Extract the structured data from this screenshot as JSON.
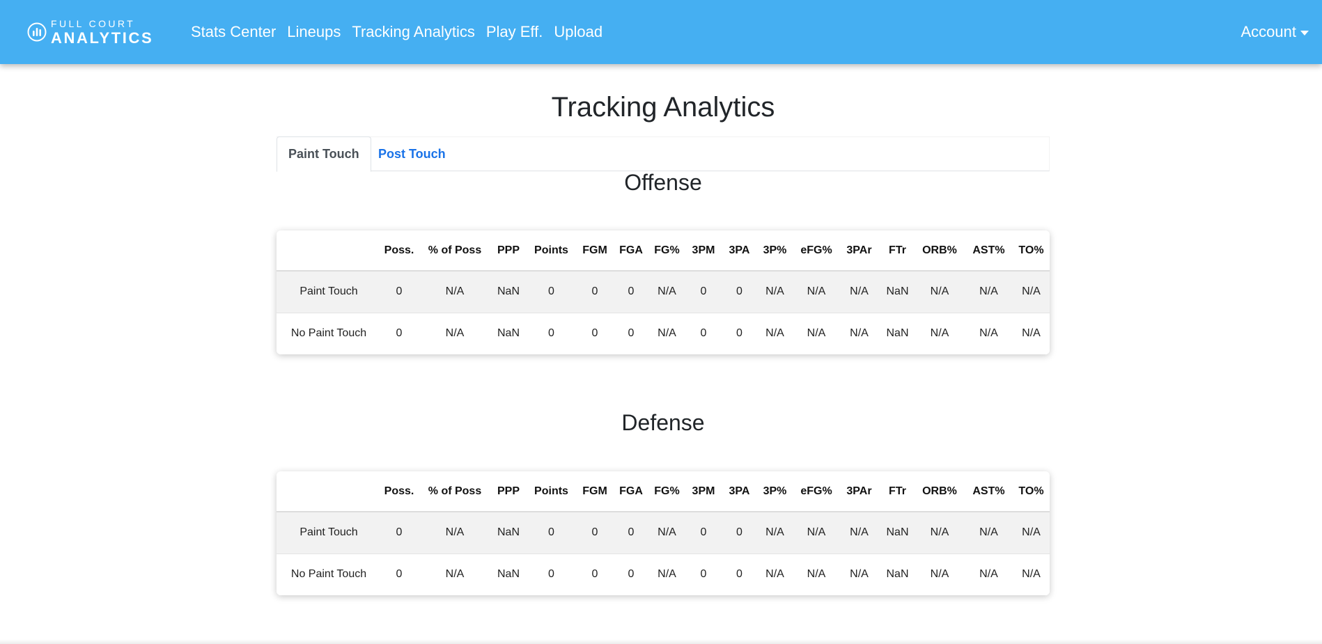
{
  "navbar": {
    "brand_top": "FULL COURT",
    "brand_bottom": "ANALYTICS",
    "links": [
      "Stats Center",
      "Lineups",
      "Tracking Analytics",
      "Play Eff.",
      "Upload"
    ],
    "account_label": "Account"
  },
  "page": {
    "title": "Tracking Analytics"
  },
  "tabs": [
    {
      "label": "Paint Touch",
      "active": true
    },
    {
      "label": "Post Touch",
      "active": false
    }
  ],
  "columns": [
    "",
    "Poss.",
    "% of Poss",
    "PPP",
    "Points",
    "FGM",
    "FGA",
    "FG%",
    "3PM",
    "3PA",
    "3P%",
    "eFG%",
    "3PAr",
    "FTr",
    "ORB%",
    "AST%",
    "TO%"
  ],
  "offense": {
    "title": "Offense",
    "rows": [
      [
        "Paint Touch",
        "0",
        "N/A",
        "NaN",
        "0",
        "0",
        "0",
        "N/A",
        "0",
        "0",
        "N/A",
        "N/A",
        "N/A",
        "NaN",
        "N/A",
        "N/A",
        "N/A"
      ],
      [
        "No Paint Touch",
        "0",
        "N/A",
        "NaN",
        "0",
        "0",
        "0",
        "N/A",
        "0",
        "0",
        "N/A",
        "N/A",
        "N/A",
        "NaN",
        "N/A",
        "N/A",
        "N/A"
      ]
    ]
  },
  "defense": {
    "title": "Defense",
    "rows": [
      [
        "Paint Touch",
        "0",
        "N/A",
        "NaN",
        "0",
        "0",
        "0",
        "N/A",
        "0",
        "0",
        "N/A",
        "N/A",
        "N/A",
        "NaN",
        "N/A",
        "N/A",
        "N/A"
      ],
      [
        "No Paint Touch",
        "0",
        "N/A",
        "NaN",
        "0",
        "0",
        "0",
        "N/A",
        "0",
        "0",
        "N/A",
        "N/A",
        "N/A",
        "NaN",
        "N/A",
        "N/A",
        "N/A"
      ]
    ]
  },
  "colors": {
    "navbar_bg": "#45aff2",
    "link_blue": "#1a73e8",
    "row_shade": "#f2f2f2"
  },
  "icons": {
    "brand": "bar-chart-circle-icon",
    "account": "caret-down-icon"
  }
}
